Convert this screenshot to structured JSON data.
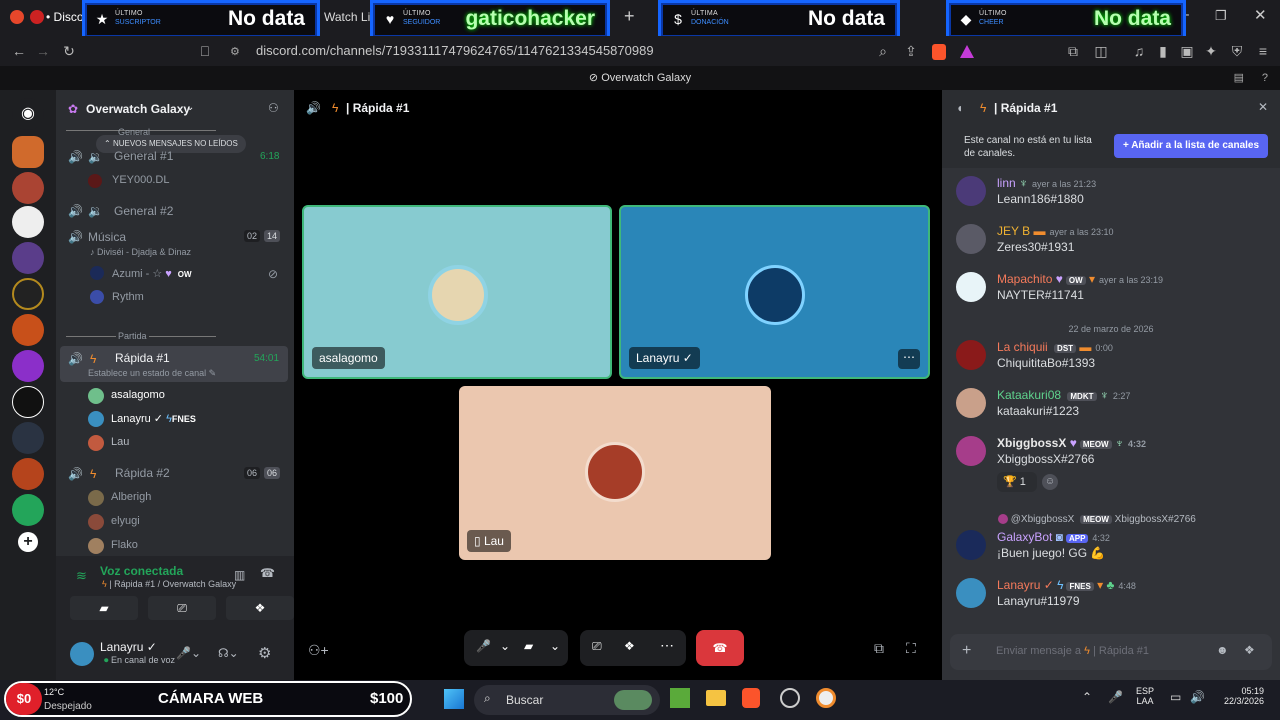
{
  "browser": {
    "tab_label": "• Discor",
    "tab2_label": "Watch Live",
    "url": "discord.com/channels/719331117479624765/1147621334545870989",
    "window_title": "Overwatch Galaxy"
  },
  "overlays": [
    {
      "line1": "ÚLTIMO",
      "line2": "SUSCRIPTOR",
      "value": "No data"
    },
    {
      "line1": "ÚLTIMO",
      "line2": "SEGUIDOR",
      "value": "gaticohacker"
    },
    {
      "line1": "ÚLTIMA",
      "line2": "DONACIÓN",
      "value": "No data"
    },
    {
      "line1": "ÚLTIMO",
      "line2": "CHEER",
      "value": "No data"
    }
  ],
  "server": {
    "name": "Overwatch Galaxy"
  },
  "channels": {
    "unread_pill": "NUEVOS MENSAJES NO LEÍDOS",
    "cat_general": "General",
    "general1": "General #1",
    "general1_time": "6:18",
    "general1_user": "YEY000.DL",
    "general2": "General #2",
    "musica": "Música",
    "musica_c1": "02",
    "musica_c2": "14",
    "musica_status": "Diviséi - Djadja & Dinaz",
    "azumi": "Azumi - ☆",
    "azumi_tag": "OW",
    "rythm": "Rythm",
    "cat_partida": "Partida",
    "rapida1": "Rápida #1",
    "rapida1_time": "54:01",
    "rapida1_status": "Establece un estado de canal",
    "u_asalagomo": "asalagomo",
    "u_lanayru": "Lanayru ✓",
    "u_lanayru_tag": "FNES",
    "u_lau": "Lau",
    "rapida2": "Rápida #2",
    "rapida2_c1": "06",
    "rapida2_c2": "06",
    "u_alberigh": "Alberigh",
    "u_elyugi": "elyugi",
    "u_flako": "Flako"
  },
  "voice": {
    "status": "Voz conectada",
    "location": "Rápida #1 / Overwatch Galaxy"
  },
  "user": {
    "name": "Lanayru ✓",
    "status": "En canal de voz"
  },
  "stage": {
    "title": "Rápida #1",
    "tiles": [
      "asalagomo",
      "Lanayru ✓",
      "Lau"
    ]
  },
  "chatpanel": {
    "title": "Rápida #1",
    "notice": "Este canal no está en tu lista de canales.",
    "add_button": "Añadir a la lista de canales",
    "date_divider": "22 de marzo de 2026",
    "input_placeholder": "Enviar mensaje a",
    "input_channel": "Rápida #1"
  },
  "messages": [
    {
      "name": "linn",
      "time": "ayer a las 21:23",
      "text": "Leann186#1880",
      "color": "#c9a2ff"
    },
    {
      "name": "JEY B",
      "time": "ayer a las 23:10",
      "text": "Zeres30#1931",
      "color": "#f0b232"
    },
    {
      "name": "Mapachito",
      "tag": "OW",
      "time": "ayer a las 23:19",
      "text": "NAYTER#11741",
      "color": "#f57a5b"
    },
    {
      "name": "La chiquii",
      "tag": "DST",
      "time": "0:00",
      "text": "ChiquititaBo#1393",
      "color": "#f57a5b"
    },
    {
      "name": "Kataakuri08",
      "tag": "MDKT",
      "time": "2:27",
      "text": "kataakuri#1223",
      "color": "#5fd38d"
    },
    {
      "name": "XbiggbossX",
      "tag": "MEOW",
      "time": "4:32",
      "text": "XbiggbossX#2766",
      "color": "#e9e9e9"
    },
    {
      "name": "GalaxyBot",
      "tag": "APP",
      "time": "4:32",
      "text": "¡Buen juego! GG 💪",
      "color": "#c9a2ff"
    },
    {
      "name": "Lanayru ✓",
      "tag": "FNES",
      "time": "4:48",
      "text": "Lanayru#11979",
      "color": "#f57a5b"
    }
  ],
  "reaction_count": "1",
  "reply": {
    "name": "@XbiggbossX",
    "tag": "MEOW",
    "text": "XbiggbossX#2766"
  },
  "taskbar": {
    "cam_amount": "$0",
    "cam_label": "CÁMARA WEB",
    "cam_goal": "$100",
    "temp": "12°C",
    "weather": "Despejado",
    "search": "Buscar",
    "lang1": "ESP",
    "lang2": "LAA",
    "time": "05:19",
    "date": "22/3/2026"
  }
}
